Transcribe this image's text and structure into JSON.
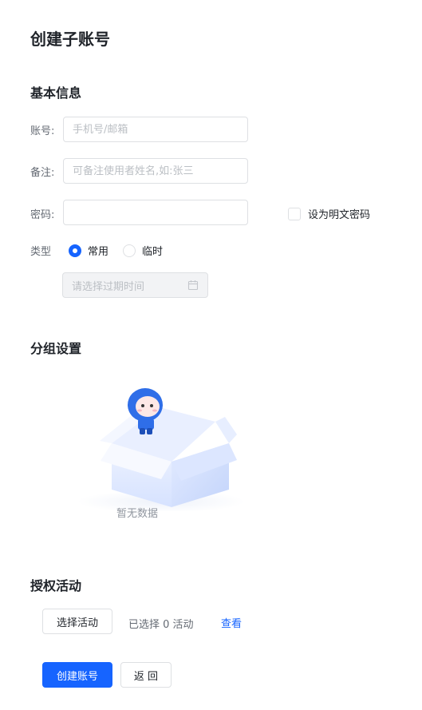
{
  "page": {
    "title": "创建子账号"
  },
  "basic_info": {
    "section_title": "基本信息",
    "account": {
      "label": "账号:",
      "placeholder": "手机号/邮箱",
      "value": ""
    },
    "remark": {
      "label": "备注:",
      "placeholder": "可备注使用者姓名,如:张三",
      "value": ""
    },
    "password": {
      "label": "密码:",
      "value": ""
    },
    "show_password": {
      "label": "设为明文密码",
      "checked": false
    },
    "type": {
      "label": "类型",
      "options": [
        {
          "label": "常用",
          "checked": true
        },
        {
          "label": "临时",
          "checked": false
        }
      ]
    },
    "expire_time": {
      "placeholder": "请选择过期时间",
      "icon": "calendar-icon"
    }
  },
  "group_settings": {
    "section_title": "分组设置",
    "empty_text": "暂无数据"
  },
  "authorized_activities": {
    "section_title": "授权活动",
    "select_button": "选择活动",
    "selected_text": "已选择 0 活动",
    "view_link": "查看"
  },
  "actions": {
    "create_button": "创建账号",
    "back_button": "返 回"
  },
  "colors": {
    "primary": "#1664ff",
    "text": "#1f2329",
    "muted": "#646a73",
    "placeholder": "#bbbfc4",
    "border": "#dee0e3"
  }
}
